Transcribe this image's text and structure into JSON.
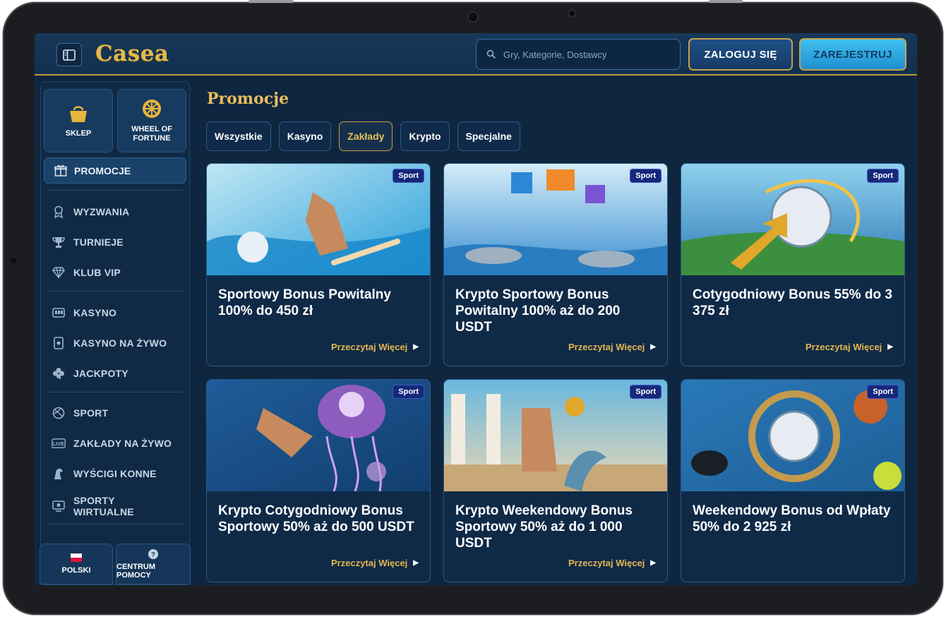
{
  "brand": {
    "logo_text": "Casea"
  },
  "header": {
    "search_placeholder": "Gry, Kategorie, Dostawcy",
    "login_label": "ZALOGUJ SIĘ",
    "register_label": "ZAREJESTRUJ"
  },
  "sidebar": {
    "tiles": [
      {
        "label": "SKLEP",
        "icon": "shop-bag-icon"
      },
      {
        "label": "WHEEL OF FORTUNE",
        "icon": "wheel-icon"
      }
    ],
    "promo": {
      "label": "PROMOCJE",
      "icon": "gift-icon"
    },
    "groups": [
      [
        {
          "label": "WYZWANIA",
          "icon": "medal-icon"
        },
        {
          "label": "TURNIEJE",
          "icon": "trophy-icon"
        },
        {
          "label": "KLUB VIP",
          "icon": "diamond-icon"
        }
      ],
      [
        {
          "label": "KASYNO",
          "icon": "slot-icon"
        },
        {
          "label": "KASYNO NA ŻYWO",
          "icon": "live-casino-icon"
        },
        {
          "label": "JACKPOTY",
          "icon": "clover-icon"
        }
      ],
      [
        {
          "label": "SPORT",
          "icon": "ball-icon"
        },
        {
          "label": "ZAKŁADY NA ŻYWO",
          "icon": "live-icon"
        },
        {
          "label": "WYŚCIGI KONNE",
          "icon": "horse-icon"
        },
        {
          "label": "SPORTY WIRTUALNE",
          "icon": "virtual-icon"
        }
      ]
    ],
    "bottom": [
      {
        "label": "POLSKI",
        "icon": "flag-pl-icon"
      },
      {
        "label": "CENTRUM POMOCY",
        "icon": "help-icon"
      }
    ]
  },
  "main": {
    "title": "Promocje",
    "filters": [
      {
        "label": "Wszystkie",
        "active": false
      },
      {
        "label": "Kasyno",
        "active": false
      },
      {
        "label": "Zakłady",
        "active": true
      },
      {
        "label": "Krypto",
        "active": false
      },
      {
        "label": "Specjalne",
        "active": false
      }
    ],
    "read_more": "Przeczytaj Więcej",
    "cards": [
      {
        "badge": "Sport",
        "title": "Sportowy Bonus Powitalny 100% do 450 zł",
        "colors": [
          "#2a9fd8",
          "#bfe7f5"
        ]
      },
      {
        "badge": "Sport",
        "title": "Krypto Sportowy Bonus Powitalny 100% aż do 200 USDT",
        "colors": [
          "#3b8fd0",
          "#d4ecf7"
        ]
      },
      {
        "badge": "Sport",
        "title": "Cotygodniowy Bonus 55% do 3 375 zł",
        "colors": [
          "#2f78b5",
          "#8fd2ee"
        ]
      },
      {
        "badge": "Sport",
        "title": "Krypto Cotygodniowy Bonus Sportowy 50% aż do 500 USDT",
        "colors": [
          "#1f5c9a",
          "#a25fc9"
        ]
      },
      {
        "badge": "Sport",
        "title": "Krypto Weekendowy Bonus Sportowy 50% aż do 1 000 USDT",
        "colors": [
          "#6ab8de",
          "#e8d7b4"
        ]
      },
      {
        "badge": "Sport",
        "title": "Weekendowy Bonus od Wpłaty 50% do 2 925 zł",
        "colors": [
          "#1e5f96",
          "#c49a4c"
        ]
      }
    ]
  }
}
